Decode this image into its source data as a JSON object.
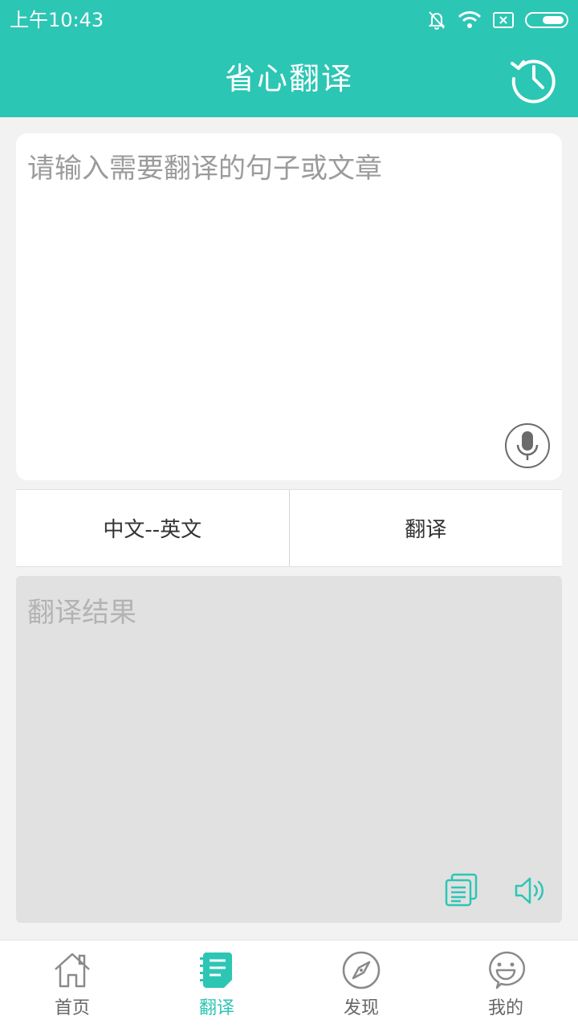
{
  "status_bar": {
    "time": "上午10:43"
  },
  "header": {
    "title": "省心翻译",
    "history_icon": "history-icon"
  },
  "input": {
    "placeholder": "请输入需要翻译的句子或文章",
    "value": "",
    "mic_icon": "microphone-icon"
  },
  "actions": {
    "language_pair": "中文--英文",
    "translate_label": "翻译"
  },
  "result": {
    "placeholder": "翻译结果",
    "copy_icon": "copy-icon",
    "speaker_icon": "speaker-icon"
  },
  "bottom_nav": {
    "items": [
      {
        "label": "首页",
        "icon": "home-icon",
        "active": false
      },
      {
        "label": "翻译",
        "icon": "translate-notebook-icon",
        "active": true
      },
      {
        "label": "发现",
        "icon": "compass-icon",
        "active": false
      },
      {
        "label": "我的",
        "icon": "smiley-profile-icon",
        "active": false
      }
    ]
  },
  "colors": {
    "accent": "#2cc6b4",
    "background": "#f2f2f2",
    "result_background": "#e1e1e1",
    "inactive_nav": "#666666"
  }
}
